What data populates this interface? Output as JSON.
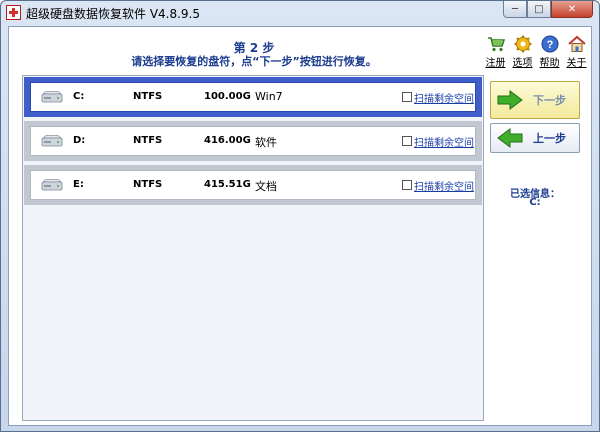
{
  "window": {
    "title": "超级硬盘数据恢复软件 V4.8.9.5",
    "minimize": "─",
    "maximize": "□",
    "close": "✕"
  },
  "header": {
    "step_title": "第 2 步",
    "instruction": "请选择要恢复的盘符，点“下一步”按钮进行恢复。"
  },
  "toolbar": [
    {
      "label": "注册",
      "icon": "cart-icon"
    },
    {
      "label": "选项",
      "icon": "gear-icon"
    },
    {
      "label": "帮助",
      "icon": "help-icon"
    },
    {
      "label": "关于",
      "icon": "home-icon"
    }
  ],
  "drives": [
    {
      "letter": "C:",
      "fs": "NTFS",
      "size": "100.00G",
      "name": "Win7",
      "scan_label": "扫描剩余空间",
      "selected": true
    },
    {
      "letter": "D:",
      "fs": "NTFS",
      "size": "416.00G",
      "name": "软件",
      "scan_label": "扫描剩余空间",
      "selected": false
    },
    {
      "letter": "E:",
      "fs": "NTFS",
      "size": "415.51G",
      "name": "文档",
      "scan_label": "扫描剩余空间",
      "selected": false
    }
  ],
  "buttons": {
    "next": "下一步",
    "prev": "上一步"
  },
  "selected_info": {
    "label": "已选信息：",
    "value": "C:"
  },
  "colors": {
    "accent": "#1d3d8f",
    "selected_border": "#3f5ec9",
    "next_arrow": "#3fae2a",
    "prev_arrow": "#3fae2a"
  }
}
